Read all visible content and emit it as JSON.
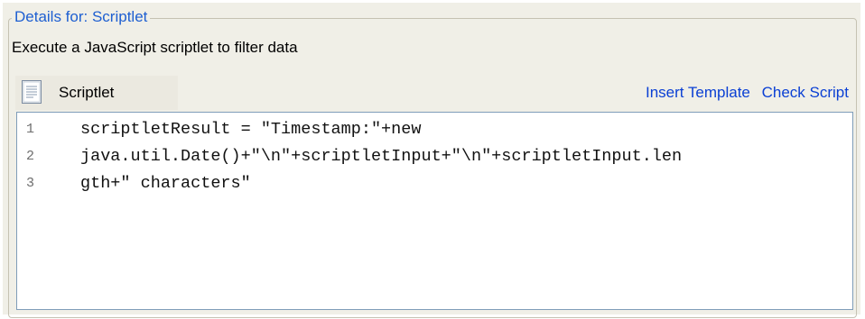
{
  "details_group": {
    "title": "Details for: Scriptlet",
    "description": "Execute a JavaScript scriptlet to filter data"
  },
  "toolbar": {
    "tab_icon": "document-icon",
    "tab_label": "Scriptlet",
    "insert_template_label": "Insert Template",
    "check_script_label": "Check Script"
  },
  "editor": {
    "lines": [
      {
        "number": "1",
        "text": "scriptletResult = \"Timestamp:\"+new"
      },
      {
        "number": "2",
        "text": "java.util.Date()+\"\\n\"+scriptletInput+\"\\n\"+scriptletInput.len"
      },
      {
        "number": "3",
        "text": "gth+\" characters\""
      }
    ]
  },
  "colors": {
    "panel_background": "#f0efe7",
    "group_title": "#1e5fd1",
    "link": "#0b40d4",
    "editor_border": "#7f9db9"
  }
}
